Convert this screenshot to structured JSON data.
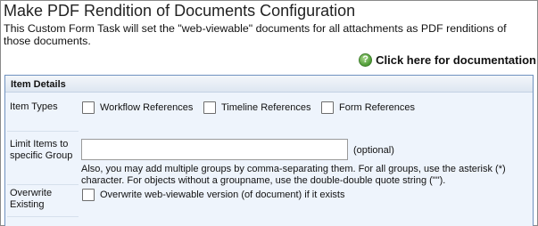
{
  "header": {
    "title": "Make PDF Rendition of Documents Configuration",
    "description": "This Custom Form Task will set the \"web-viewable\" documents for all attachments as PDF renditions of those documents."
  },
  "documentation_link": {
    "label": "Click here for documentation",
    "icon": "help-icon"
  },
  "item_details": {
    "title": "Item Details",
    "item_types": {
      "label": "Item Types",
      "options": [
        {
          "label": "Workflow References",
          "checked": false
        },
        {
          "label": "Timeline References",
          "checked": false
        },
        {
          "label": "Form References",
          "checked": false
        }
      ]
    },
    "limit_group": {
      "label": "Limit Items to specific Group",
      "value": "",
      "optional_text": "(optional)",
      "help_text": "Also, you may add multiple groups by comma-separating them. For all groups, use the asterisk (*) character. For objects without a groupname, use the double-double quote string (\"\")."
    },
    "overwrite": {
      "label": "Overwrite Existing",
      "checkbox_label": "Overwrite web-viewable version (of document) if it exists",
      "checked": false
    }
  },
  "colors": {
    "panel_border": "#6f91bf",
    "panel_background": "#eef4fc",
    "help_icon": "#4d9a35"
  }
}
